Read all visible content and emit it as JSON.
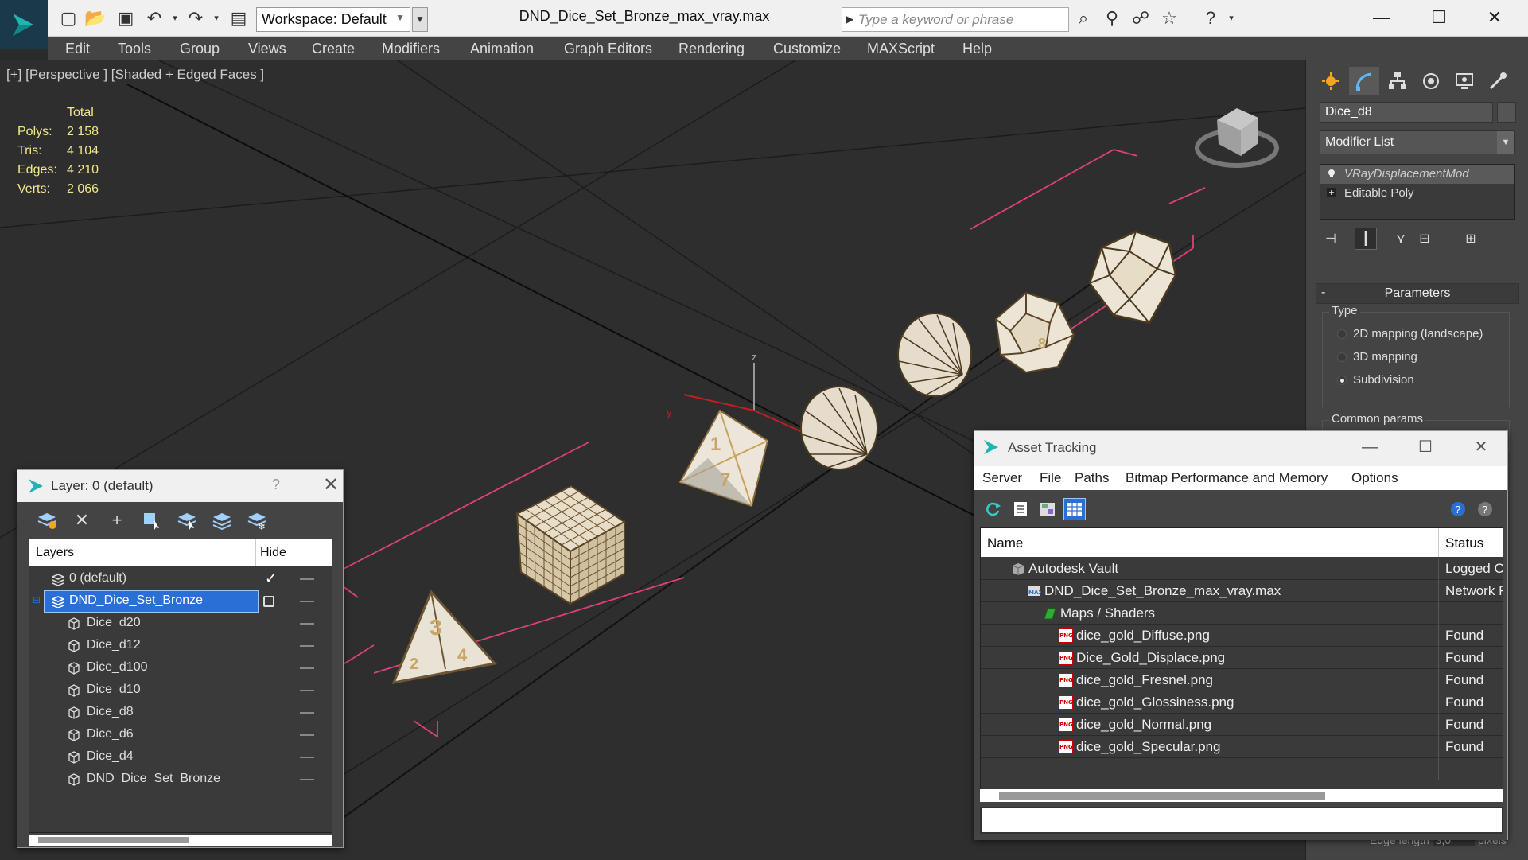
{
  "titlebar": {
    "workspace": "Workspace: Default",
    "doc_title": "DND_Dice_Set_Bronze_max_vray.max",
    "search_placeholder": "Type a keyword or phrase"
  },
  "menu": [
    "Edit",
    "Tools",
    "Group",
    "Views",
    "Create",
    "Modifiers",
    "Animation",
    "Graph Editors",
    "Rendering",
    "Customize",
    "MAXScript",
    "Help"
  ],
  "viewport": {
    "label": "[+] [Perspective ] [Shaded + Edged Faces ]",
    "stats": {
      "header": "Total",
      "rows": [
        {
          "k": "Polys:",
          "v": "2 158"
        },
        {
          "k": "Tris:",
          "v": "4 104"
        },
        {
          "k": "Edges:",
          "v": "4 210"
        },
        {
          "k": "Verts:",
          "v": "2 066"
        }
      ]
    },
    "dice_labels": {
      "d4_a": "3",
      "d4_b": "4",
      "d4_c": "2",
      "d8_a": "1",
      "d8_b": "7",
      "d12_a": "8"
    },
    "gizmo_axes": {
      "z": "z",
      "y": "y"
    }
  },
  "cmdpanel": {
    "object_name": "Dice_d8",
    "modifier_list": "Modifier List",
    "stack": [
      {
        "label": "VRayDisplacementMod",
        "selected": true
      },
      {
        "label": "Editable Poly",
        "selected": false
      }
    ],
    "rollout_title": "Parameters",
    "type_group": "Type",
    "radios": [
      {
        "label": "2D mapping (landscape)",
        "checked": false
      },
      {
        "label": "3D mapping",
        "checked": false
      },
      {
        "label": "Subdivision",
        "checked": true
      }
    ],
    "common_params": "Common params",
    "edge_length_label": "Edge length",
    "edge_length_value": "3,0",
    "edge_length_unit": "pixels"
  },
  "layer_dialog": {
    "title": "Layer: 0 (default)",
    "help": "?",
    "col_layers": "Layers",
    "col_hide": "Hide",
    "rows": [
      {
        "name": "0 (default)",
        "level": 0,
        "checked": true,
        "selected": false
      },
      {
        "name": "DND_Dice_Set_Bronze",
        "level": 0,
        "checked": false,
        "selected": true
      },
      {
        "name": "Dice_d20",
        "level": 1
      },
      {
        "name": "Dice_d12",
        "level": 1
      },
      {
        "name": "Dice_d100",
        "level": 1
      },
      {
        "name": "Dice_d10",
        "level": 1
      },
      {
        "name": "Dice_d8",
        "level": 1
      },
      {
        "name": "Dice_d6",
        "level": 1
      },
      {
        "name": "Dice_d4",
        "level": 1
      },
      {
        "name": "DND_Dice_Set_Bronze",
        "level": 1
      }
    ]
  },
  "asset_dialog": {
    "title": "Asset Tracking",
    "menu": [
      "Server",
      "File",
      "Paths",
      "Bitmap Performance and Memory",
      "Options"
    ],
    "col_name": "Name",
    "col_status": "Status",
    "rows": [
      {
        "name": "Autodesk Vault",
        "status": "Logged O",
        "level": 0,
        "icon": "vault"
      },
      {
        "name": "DND_Dice_Set_Bronze_max_vray.max",
        "status": "Network F",
        "level": 1,
        "icon": "max"
      },
      {
        "name": "Maps / Shaders",
        "status": "",
        "level": 2,
        "icon": "maps"
      },
      {
        "name": "dice_gold_Diffuse.png",
        "status": "Found",
        "level": 3,
        "icon": "png"
      },
      {
        "name": "Dice_Gold_Displace.png",
        "status": "Found",
        "level": 3,
        "icon": "png"
      },
      {
        "name": "dice_gold_Fresnel.png",
        "status": "Found",
        "level": 3,
        "icon": "png"
      },
      {
        "name": "dice_gold_Glossiness.png",
        "status": "Found",
        "level": 3,
        "icon": "png"
      },
      {
        "name": "dice_gold_Normal.png",
        "status": "Found",
        "level": 3,
        "icon": "png"
      },
      {
        "name": "dice_gold_Specular.png",
        "status": "Found",
        "level": 3,
        "icon": "png"
      }
    ],
    "png_icon_text": "PNG"
  },
  "colors": {
    "selection": "#2a6fd6",
    "viewport_bg": "#2e2e2e",
    "stats_yellow": "#f0e68c",
    "bounding_box": "#e0407a"
  }
}
